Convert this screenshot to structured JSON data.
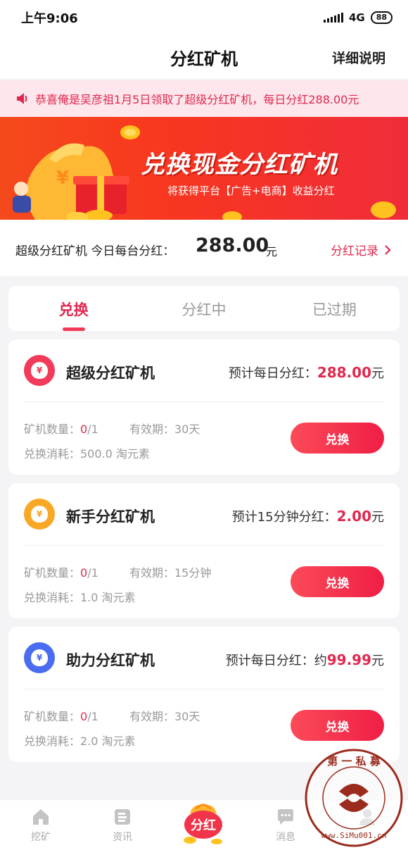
{
  "status": {
    "time": "上午9:06",
    "network": "4G",
    "battery": "88"
  },
  "nav": {
    "title": "分红矿机",
    "detail": "详细说明"
  },
  "notice": {
    "text": "恭喜俺是吴彦祖1月5日领取了超级分红矿机，每日分红288.00元"
  },
  "banner": {
    "title": "兑换现金分红矿机",
    "subtitle": "将获得平台【广告+电商】收益分红"
  },
  "today": {
    "label": "超级分红矿机 今日每台分红：",
    "value": "288.00",
    "unit": "元",
    "record": "分红记录"
  },
  "tabs": [
    "兑换",
    "分红中",
    "已过期"
  ],
  "cards": [
    {
      "name": "超级分红矿机",
      "est_label": "预计每日分红：",
      "est_prefix": "",
      "est_value": "288.00",
      "est_unit": "元",
      "qty_label": "矿机数量：",
      "qty_owned": "0",
      "qty_total": "/1",
      "valid": "有效期：30天",
      "cost": "兑换消耗：500.0 淘元素",
      "button": "兑换",
      "icon_color": "#f23a5a"
    },
    {
      "name": "新手分红矿机",
      "est_label": "预计15分钟分红：",
      "est_prefix": "",
      "est_value": "2.00",
      "est_unit": "元",
      "qty_label": "矿机数量：",
      "qty_owned": "0",
      "qty_total": "/1",
      "valid": "有效期：15分钟",
      "cost": "兑换消耗：1.0 淘元素",
      "button": "兑换",
      "icon_color": "#f9a825"
    },
    {
      "name": "助力分红矿机",
      "est_label": "预计每日分红：",
      "est_prefix": "约",
      "est_value": "99.99",
      "est_unit": "元",
      "qty_label": "矿机数量：",
      "qty_owned": "0",
      "qty_total": "/1",
      "valid": "有效期：30天",
      "cost": "兑换消耗：2.0 淘元素",
      "button": "兑换",
      "icon_color": "#4a6cf0"
    }
  ],
  "tabbar": {
    "items": [
      "挖矿",
      "资讯",
      "分红",
      "消息",
      ""
    ]
  },
  "watermark": {
    "text1": "第一私募",
    "text2": "www.simu001.cn"
  }
}
